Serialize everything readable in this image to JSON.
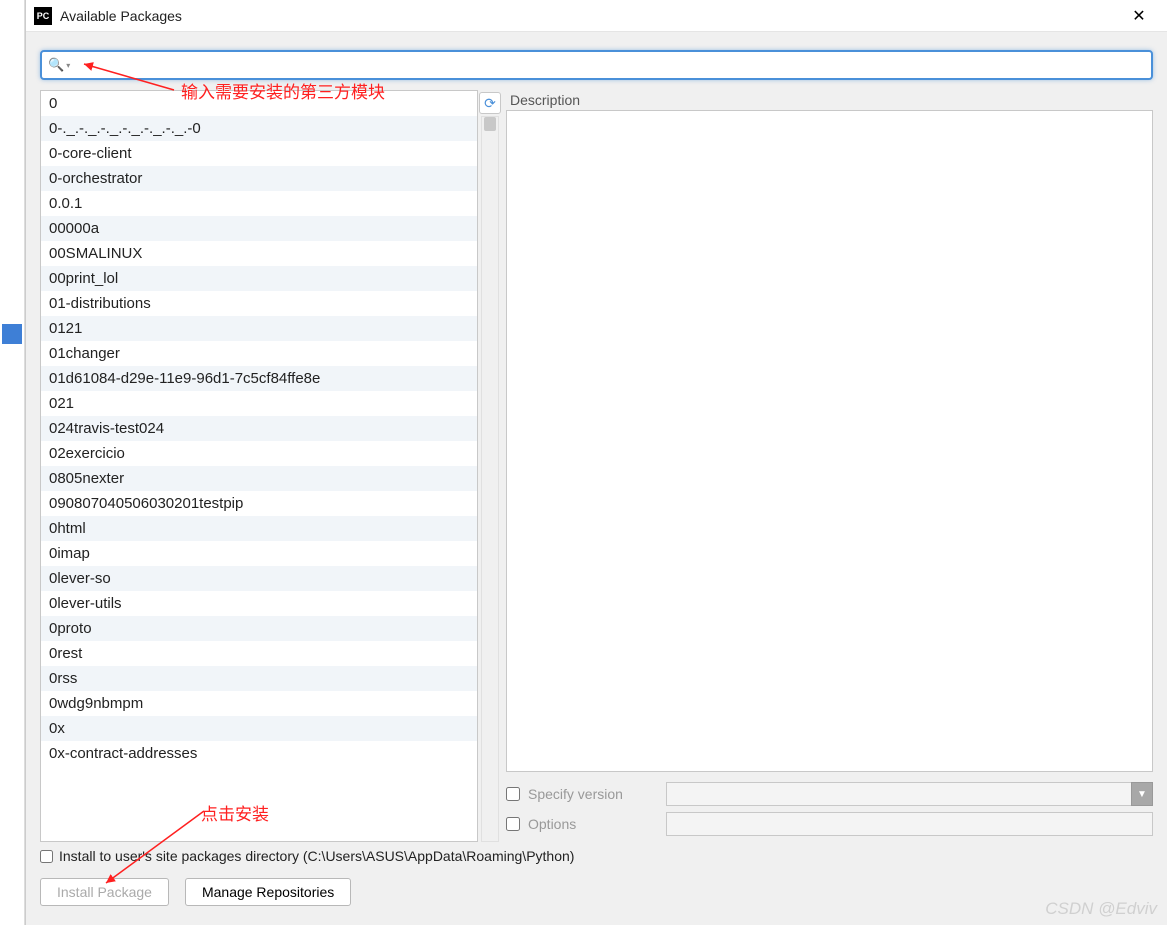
{
  "window": {
    "title": "Available Packages",
    "app_icon_text": "PC"
  },
  "search": {
    "value": ""
  },
  "packages": [
    "0",
    "0-._.-._.-._.-._.-._.-._.-0",
    "0-core-client",
    "0-orchestrator",
    "0.0.1",
    "00000a",
    "00SMALINUX",
    "00print_lol",
    "01-distributions",
    "0121",
    "01changer",
    "01d61084-d29e-11e9-96d1-7c5cf84ffe8e",
    "021",
    "024travis-test024",
    "02exercicio",
    "0805nexter",
    "090807040506030201testpip",
    "0html",
    "0imap",
    "0lever-so",
    "0lever-utils",
    "0proto",
    "0rest",
    "0rss",
    "0wdg9nbmpm",
    "0x",
    "0x-contract-addresses"
  ],
  "right": {
    "description_label": "Description",
    "specify_version_label": "Specify version",
    "options_label": "Options"
  },
  "bottom": {
    "install_user_site": "Install to user's site packages directory (C:\\Users\\ASUS\\AppData\\Roaming\\Python)",
    "install_package": "Install Package",
    "manage_repos": "Manage Repositories"
  },
  "annotations": {
    "search_hint": "输入需要安装的第三方模块",
    "install_hint": "点击安装"
  },
  "watermark": "CSDN @Edviv"
}
